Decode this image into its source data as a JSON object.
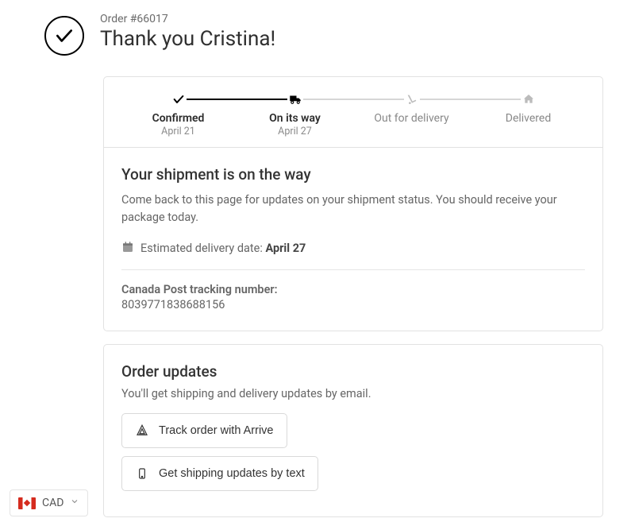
{
  "header": {
    "order_label": "Order #66017",
    "thank_you": "Thank you Cristina!"
  },
  "progress": {
    "steps": [
      {
        "label": "Confirmed",
        "date": "April 21",
        "active": true
      },
      {
        "label": "On its way",
        "date": "April 27",
        "active": true
      },
      {
        "label": "Out for delivery",
        "date": "",
        "active": false
      },
      {
        "label": "Delivered",
        "date": "",
        "active": false
      }
    ]
  },
  "shipment": {
    "title": "Your shipment is on the way",
    "description": "Come back to this page for updates on your shipment status. You should receive your package today.",
    "estimated_label": "Estimated delivery date: ",
    "estimated_date": "April 27",
    "tracking_carrier_label": "Canada Post tracking number:",
    "tracking_number": "8039771838688156"
  },
  "updates": {
    "title": "Order updates",
    "description": "You'll get shipping and delivery updates by email.",
    "track_button": "Track order with Arrive",
    "text_button": "Get shipping updates by text"
  },
  "currency": {
    "code": "CAD"
  }
}
